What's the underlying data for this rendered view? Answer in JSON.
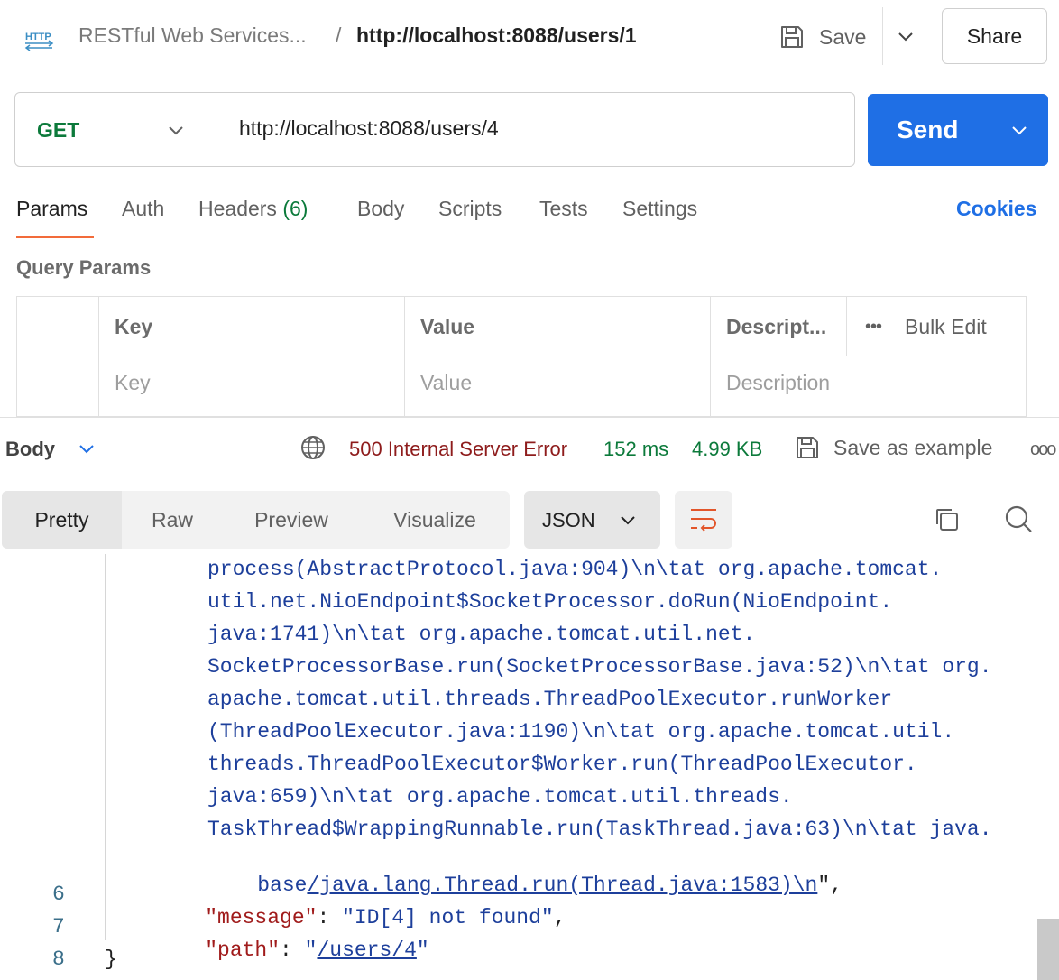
{
  "header": {
    "collection": "RESTful Web Services...",
    "separator": "/",
    "request_name": "http://localhost:8088/users/1",
    "save_label": "Save",
    "share_label": "Share"
  },
  "request": {
    "method": "GET",
    "url": "http://localhost:8088/users/4",
    "send_label": "Send"
  },
  "tabs": {
    "params": "Params",
    "auth": "Auth",
    "headers": "Headers",
    "headers_count": "(6)",
    "body": "Body",
    "scripts": "Scripts",
    "tests": "Tests",
    "settings": "Settings",
    "cookies": "Cookies"
  },
  "query_params": {
    "title": "Query Params",
    "columns": [
      "Key",
      "Value",
      "Descript..."
    ],
    "bulk_edit": "Bulk Edit",
    "placeholders": [
      "Key",
      "Value",
      "Description"
    ]
  },
  "response": {
    "label": "Body",
    "status": "500 Internal Server Error",
    "time": "152 ms",
    "size": "4.99 KB",
    "save_example": "Save as example",
    "view_tabs": [
      "Pretty",
      "Raw",
      "Preview",
      "Visualize"
    ],
    "format": "JSON"
  },
  "code": {
    "trace_lines": [
      "process(AbstractProtocol.java:904)\\n\\tat org.apache.tomcat.",
      "util.net.NioEndpoint$SocketProcessor.doRun(NioEndpoint.",
      "java:1741)\\n\\tat org.apache.tomcat.util.net.",
      "SocketProcessorBase.run(SocketProcessorBase.java:52)\\n\\tat org.",
      "apache.tomcat.util.threads.ThreadPoolExecutor.runWorker",
      "(ThreadPoolExecutor.java:1190)\\n\\tat org.apache.tomcat.util.",
      "threads.ThreadPoolExecutor$Worker.run(ThreadPoolExecutor.",
      "java:659)\\n\\tat org.apache.tomcat.util.threads.",
      "TaskThread$WrappingRunnable.run(TaskThread.java:63)\\n\\tat java."
    ],
    "last_trace_prefix": "base",
    "last_trace_link": "/java.lang.Thread.run(Thread.java:1583)\\n",
    "last_trace_suffix": "\",",
    "line6_num": "6",
    "line6_key": "\"message\"",
    "line6_colon": ": ",
    "line6_value": "\"ID[4] not found\"",
    "line6_comma": ",",
    "line7_num": "7",
    "line7_key": "\"path\"",
    "line7_colon": ": ",
    "line7_quote_open": "\"",
    "line7_value": "/users/4",
    "line7_quote_close": "\"",
    "line8_num": "8",
    "line8_text": "}"
  }
}
